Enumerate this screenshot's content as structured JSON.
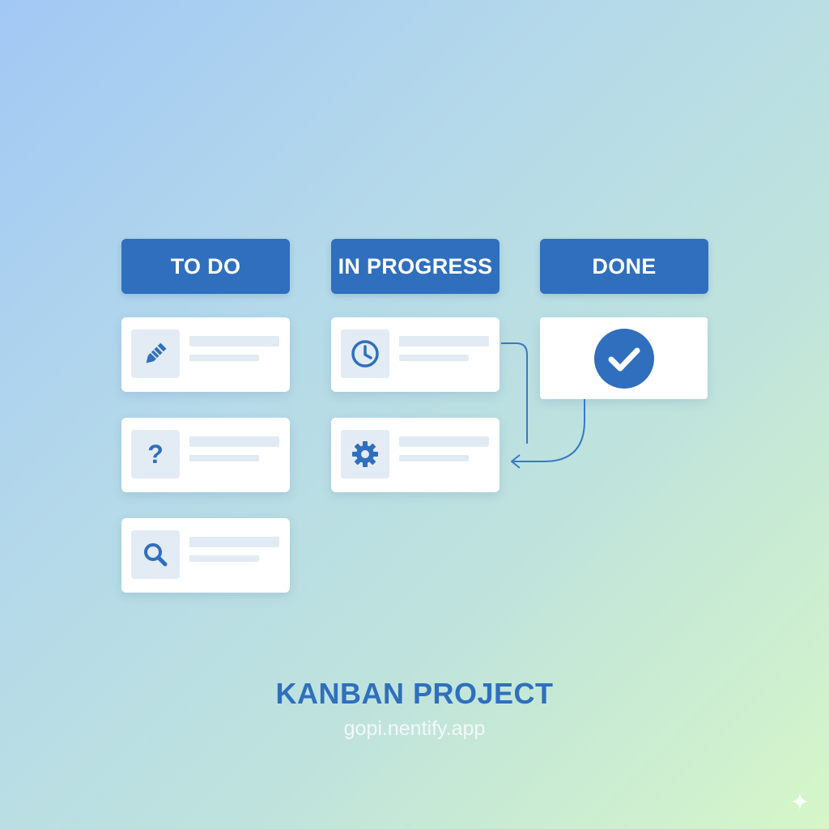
{
  "columns": [
    {
      "title": "TO DO"
    },
    {
      "title": "IN PROGRESS"
    },
    {
      "title": "DONE"
    }
  ],
  "cards": {
    "todo": [
      {
        "icon": "pencil-icon"
      },
      {
        "icon": "question-icon",
        "glyph": "?"
      },
      {
        "icon": "search-icon"
      }
    ],
    "in_progress": [
      {
        "icon": "clock-icon"
      },
      {
        "icon": "gear-icon"
      }
    ],
    "done": [
      {
        "icon": "check-circle-icon"
      }
    ]
  },
  "footer": {
    "title": "KANBAN PROJECT",
    "url": "gopi.nentify.app"
  },
  "colors": {
    "accent": "#2f6fbd",
    "card": "#ffffff",
    "placeholder": "#e2eaf3",
    "icon_box": "#e3ebf4"
  }
}
